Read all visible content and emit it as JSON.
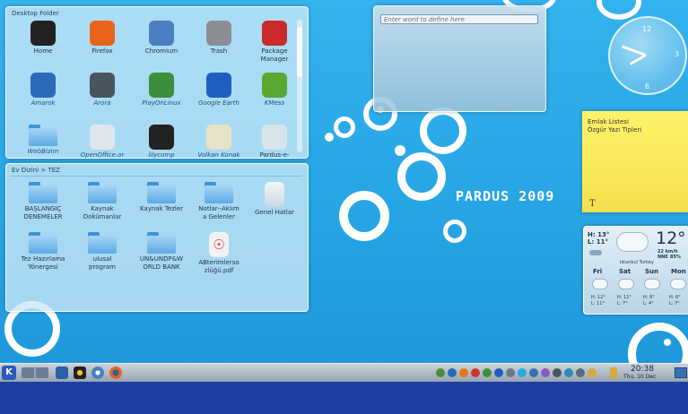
{
  "desktop_folder": {
    "title": "Desktop Folder",
    "items": [
      {
        "label": "Home",
        "icon": "penguin-icon",
        "color": "#222222"
      },
      {
        "label": "Firefox",
        "icon": "firefox-icon",
        "color": "#e8641a"
      },
      {
        "label": "Chromium",
        "icon": "chromium-icon",
        "color": "#4a7fc1"
      },
      {
        "label": "Trash",
        "icon": "trash-icon",
        "color": "#8a8f94"
      },
      {
        "label": "Package\nManager",
        "icon": "package-manager-icon",
        "color": "#cc2a2a"
      },
      {
        "label": "Amarok",
        "icon": "amarok-icon",
        "color": "#2b6ab8"
      },
      {
        "label": "Arora",
        "icon": "arora-icon",
        "color": "#4a5560"
      },
      {
        "label": "PlayOnLinux",
        "icon": "playonlinux-icon",
        "color": "#3b8f3b"
      },
      {
        "label": "Google Earth",
        "icon": "google-earth-icon",
        "color": "#1f5fbf"
      },
      {
        "label": "KMess",
        "icon": "kmess-icon",
        "color": "#5aa832"
      },
      {
        "label": "WebBizim",
        "icon": "folder-icon",
        "color": "#5aa9e5"
      },
      {
        "label": "OpenOffice.or",
        "icon": "openoffice-icon",
        "color": "#dfe6ec"
      },
      {
        "label": "lilycomp",
        "icon": "piano-icon",
        "color": "#222222"
      },
      {
        "label": "Volkan Konak",
        "icon": "music-file-icon",
        "color": "#e7e2c8"
      },
      {
        "label": "Pardus-e-",
        "icon": "document-icon",
        "color": "#d8e4ec"
      }
    ]
  },
  "home_folder": {
    "title": "Ev Dizini > TEZ",
    "items": [
      {
        "label": "BAŞLANGIÇ\nDENEMELER",
        "icon": "folder-icon"
      },
      {
        "label": "Kaynak\nDokümanlar",
        "icon": "folder-icon"
      },
      {
        "label": "Kaynak Tezler",
        "icon": "folder-icon"
      },
      {
        "label": "Notlar--Aklım\na Gelenler",
        "icon": "folder-icon"
      },
      {
        "label": "Genel Hatlar",
        "icon": "document-icon"
      },
      {
        "label": "Tez Hazırlama\nYönergesi",
        "icon": "folder-icon"
      },
      {
        "label": "ulusal\nprogram",
        "icon": "folder-icon"
      },
      {
        "label": "UN&UNDP&W\nORLD BANK",
        "icon": "folder-icon"
      },
      {
        "label": "ABterimlerso\nzlüğü.pdf",
        "icon": "pdf-icon"
      }
    ]
  },
  "dictionary": {
    "placeholder": "Enter word to define here"
  },
  "clock": {
    "numerals": [
      "12",
      "3",
      "6"
    ]
  },
  "note": {
    "line1": "Emlak Listesi",
    "line2": "Özgür Yazı Tipleri",
    "format_glyph": "T"
  },
  "wallpaper": {
    "brand": "PARDUS 2009"
  },
  "weather": {
    "high": "H: 13°",
    "low": "L: 11°",
    "temp": "12°",
    "wind": "22 km/h NNE",
    "humidity": "85%",
    "location": "Istanbul Turkey",
    "days": [
      {
        "name": "Fri",
        "high": "H: 12°",
        "low": "L: 11°"
      },
      {
        "name": "Sat",
        "high": "H: 11°",
        "low": "L: 7°"
      },
      {
        "name": "Sun",
        "high": "H: 8°",
        "low": "L: 4°"
      },
      {
        "name": "Mon",
        "high": "H: 8°",
        "low": "L: 7°"
      }
    ]
  },
  "taskbar": {
    "launcher_glyph": "K",
    "time": "20:38",
    "date": "Thu, 10 Dec"
  },
  "colors": {
    "accent": "#27a6e6",
    "taskbar_bottom": "#1f3ea3"
  }
}
